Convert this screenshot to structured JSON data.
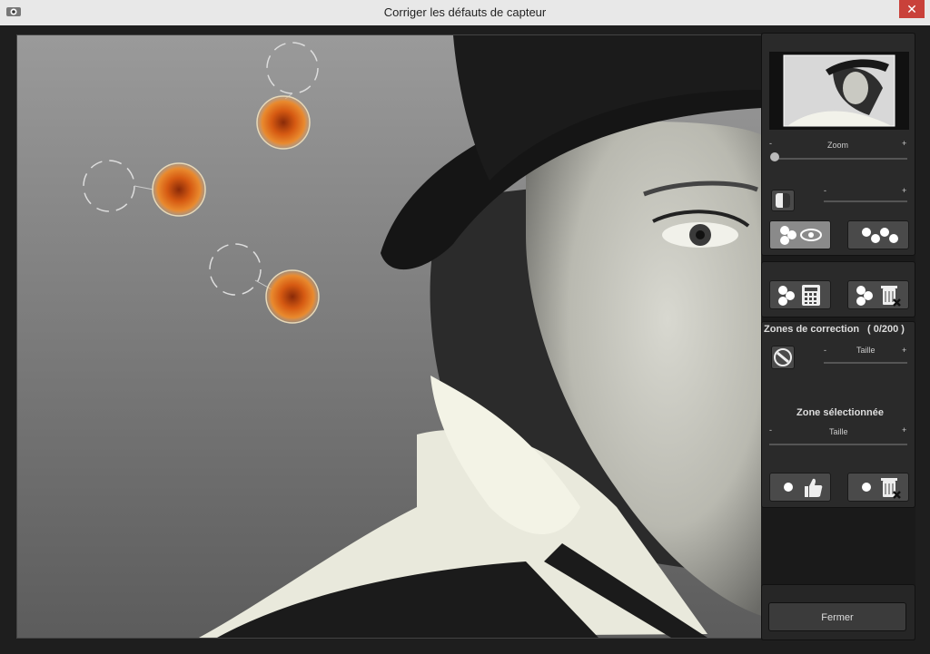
{
  "window": {
    "title": "Corriger les défauts de capteur",
    "close_glyph": "✕"
  },
  "panel": {
    "zoom_label": "Zoom",
    "minus": "-",
    "plus": "+",
    "zones_heading": "Zones de correction",
    "zones_count": "( 0/200 )",
    "taille_label": "Taille",
    "zone_selected_heading": "Zone sélectionnée",
    "close_button": "Fermer"
  },
  "colors": {
    "accent_orange": "#e8721c",
    "panel_bg": "#2a2a2a",
    "button_bg": "#4a4a4a"
  }
}
